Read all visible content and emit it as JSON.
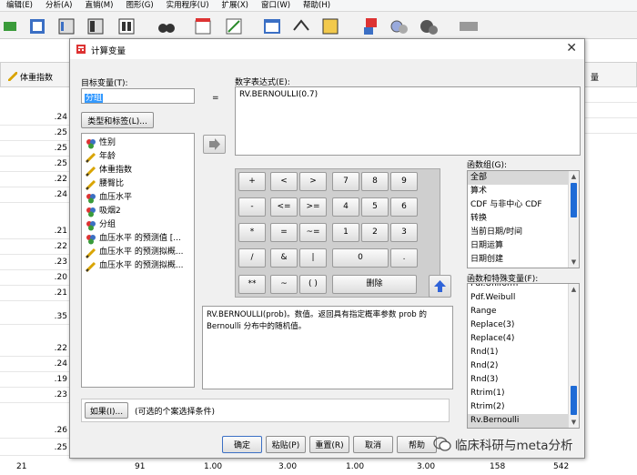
{
  "menu": [
    "编辑(E)",
    "分析(A)",
    "直销(M)",
    "图形(G)",
    "实用程序(U)",
    "扩展(X)",
    "窗口(W)",
    "帮助(H)"
  ],
  "grid": {
    "column_header": "体重指数",
    "right_header": "量",
    "values": [
      ".24",
      ".25",
      ".25",
      ".25",
      ".22",
      ".24",
      ".21",
      ".22",
      ".23",
      ".20",
      ".21",
      ".35",
      ".22",
      ".24",
      ".19",
      ".23",
      ".26",
      ".25"
    ],
    "bottom_row": [
      "21",
      "91",
      "1.00",
      "3.00",
      "1.00",
      "3.00",
      "158",
      "542"
    ]
  },
  "dialog": {
    "title": "计算变量",
    "target_label": "目标变量(T):",
    "target_value": "分组",
    "equals": "=",
    "type_button": "类型和标签(L)...",
    "expr_label": "数字表达式(E):",
    "expr_value": "RV.BERNOULLI(0.7)",
    "variables": [
      {
        "label": "性别",
        "icon": "nominal-icon"
      },
      {
        "label": "年龄",
        "icon": "scale-icon"
      },
      {
        "label": "体重指数",
        "icon": "scale-icon"
      },
      {
        "label": "腰臀比",
        "icon": "scale-icon"
      },
      {
        "label": "血压水平",
        "icon": "nominal-icon"
      },
      {
        "label": "吸烟2",
        "icon": "nominal-icon"
      },
      {
        "label": "分组",
        "icon": "nominal-icon"
      },
      {
        "label": "血压水平 的预测值 [...",
        "icon": "nominal-icon"
      },
      {
        "label": "血压水平 的预测拟概...",
        "icon": "scale-icon"
      },
      {
        "label": "血压水平 的预测拟概...",
        "icon": "scale-icon"
      }
    ],
    "keypad": {
      "rows": [
        [
          "+",
          "<",
          ">",
          "7",
          "8",
          "9"
        ],
        [
          "-",
          "<=",
          ">=",
          "4",
          "5",
          "6"
        ],
        [
          "*",
          "=",
          "~=",
          "1",
          "2",
          "3"
        ],
        [
          "/",
          "&",
          "|",
          "0",
          "."
        ],
        [
          "**",
          "~",
          "( )",
          "删除"
        ]
      ]
    },
    "description": "RV.BERNOULLI(prob)。数值。返回具有指定概率参数 prob 的 Bernoulli 分布中的随机值。",
    "func_group_label": "函数组(G):",
    "func_groups": [
      "全部",
      "算术",
      "CDF 与非中心 CDF",
      "转换",
      "当前日期/时间",
      "日期运算",
      "日期创建"
    ],
    "func_label": "函数和特殊变量(F):",
    "functions": [
      "Pdf.Uniform",
      "Pdf.Weibull",
      "Range",
      "Replace(3)",
      "Replace(4)",
      "Rnd(1)",
      "Rnd(2)",
      "Rnd(3)",
      "Rtrim(1)",
      "Rtrim(2)",
      "Rv.Bernoulli"
    ],
    "if_button": "如果(I)...",
    "if_text": "(可选的个案选择条件)",
    "buttons": {
      "ok": "确定",
      "paste": "粘贴(P)",
      "reset": "重置(R)",
      "cancel": "取消",
      "help": "帮助"
    }
  },
  "watermark": "临床科研与meta分析",
  "colors": {
    "selection": "#3399ff",
    "scroll_thumb": "#1e6bd6",
    "accent_arrow": "#2f63d8"
  }
}
